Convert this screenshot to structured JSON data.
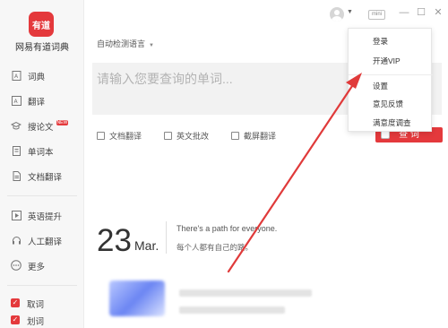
{
  "app": {
    "logo_text": "有道",
    "name": "网易有道词典"
  },
  "sidebar": {
    "items": [
      {
        "label": "词典",
        "icon": "book-icon"
      },
      {
        "label": "翻译",
        "icon": "translate-icon"
      },
      {
        "label": "搜论文",
        "icon": "paper-search-icon",
        "badge": "NEW"
      },
      {
        "label": "单词本",
        "icon": "notebook-icon"
      },
      {
        "label": "文档翻译",
        "icon": "document-icon"
      },
      {
        "label": "英语提升",
        "icon": "play-icon"
      },
      {
        "label": "人工翻译",
        "icon": "headset-icon"
      },
      {
        "label": "更多",
        "icon": "more-icon"
      }
    ],
    "checks": [
      {
        "label": "取词",
        "checked": true
      },
      {
        "label": "划词",
        "checked": true
      }
    ]
  },
  "titlebar": {
    "mini_label": "mini"
  },
  "main": {
    "language_select": "自动检测语言",
    "search_placeholder": "请输入您要查询的单词...",
    "tools": [
      "文档翻译",
      "英文批改",
      "截屏翻译"
    ],
    "search_button": "查 词"
  },
  "daily": {
    "day": "23",
    "month": "Mar.",
    "quote_en": "There's a path for everyone.",
    "quote_cn": "每个人都有自己的路。"
  },
  "menu": {
    "items": [
      "登录",
      "开通VIP",
      "设置",
      "意见反馈",
      "满意度调查"
    ]
  },
  "colors": {
    "accent": "#e4393c",
    "arrow": "#e03a3a"
  }
}
